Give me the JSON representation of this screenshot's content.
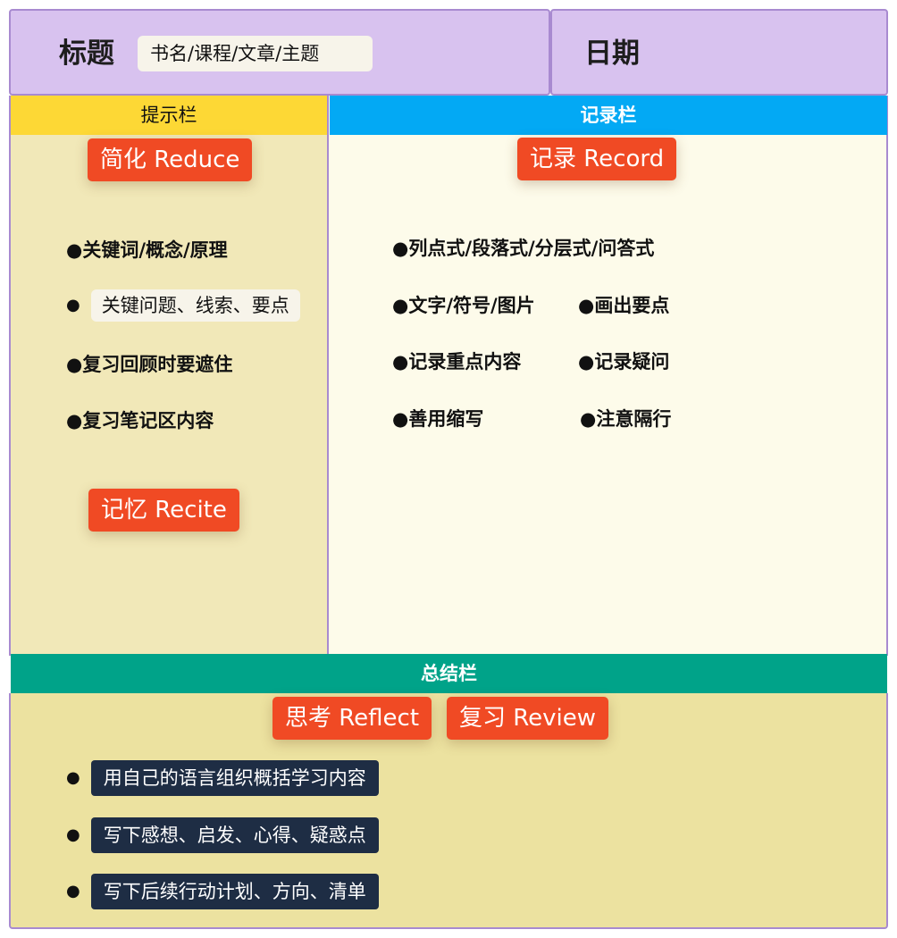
{
  "header": {
    "title_label": "标题",
    "title_placeholder": "书名/课程/文章/主题",
    "date_label": "日期"
  },
  "cue": {
    "header": "提示栏",
    "reduce_tag": "简化 Reduce",
    "items": [
      "●关键词/概念/原理",
      "关键问题、线索、要点",
      "●复习回顾时要遮住",
      "●复习笔记区内容"
    ],
    "bullet": "●",
    "recite_tag": "记忆 Recite"
  },
  "notes": {
    "header": "记录栏",
    "record_tag": "记录 Record",
    "items": {
      "formats": "●列点式/段落式/分层式/问答式",
      "media": "●文字/符号/图片",
      "highlight": "●画出要点",
      "key_content": "●记录重点内容",
      "questions": "●记录疑问",
      "abbreviations": "●善用缩写",
      "spacing": "●注意隔行"
    }
  },
  "summary": {
    "header": "总结栏",
    "reflect_tag": "思考 Reflect",
    "review_tag": "复习 Review",
    "bullet": "●",
    "items": [
      "用自己的语言组织概括学习内容",
      "写下感想、启发、心得、疑惑点",
      "写下后续行动计划、方向、清单"
    ]
  },
  "colors": {
    "header_bg": "#d8c2ef",
    "cue_bar": "#fdd835",
    "notes_bar": "#03a9f4",
    "summary_bar": "#00a389",
    "tag": "#f04a24",
    "dark_chip": "#1e2d44"
  }
}
